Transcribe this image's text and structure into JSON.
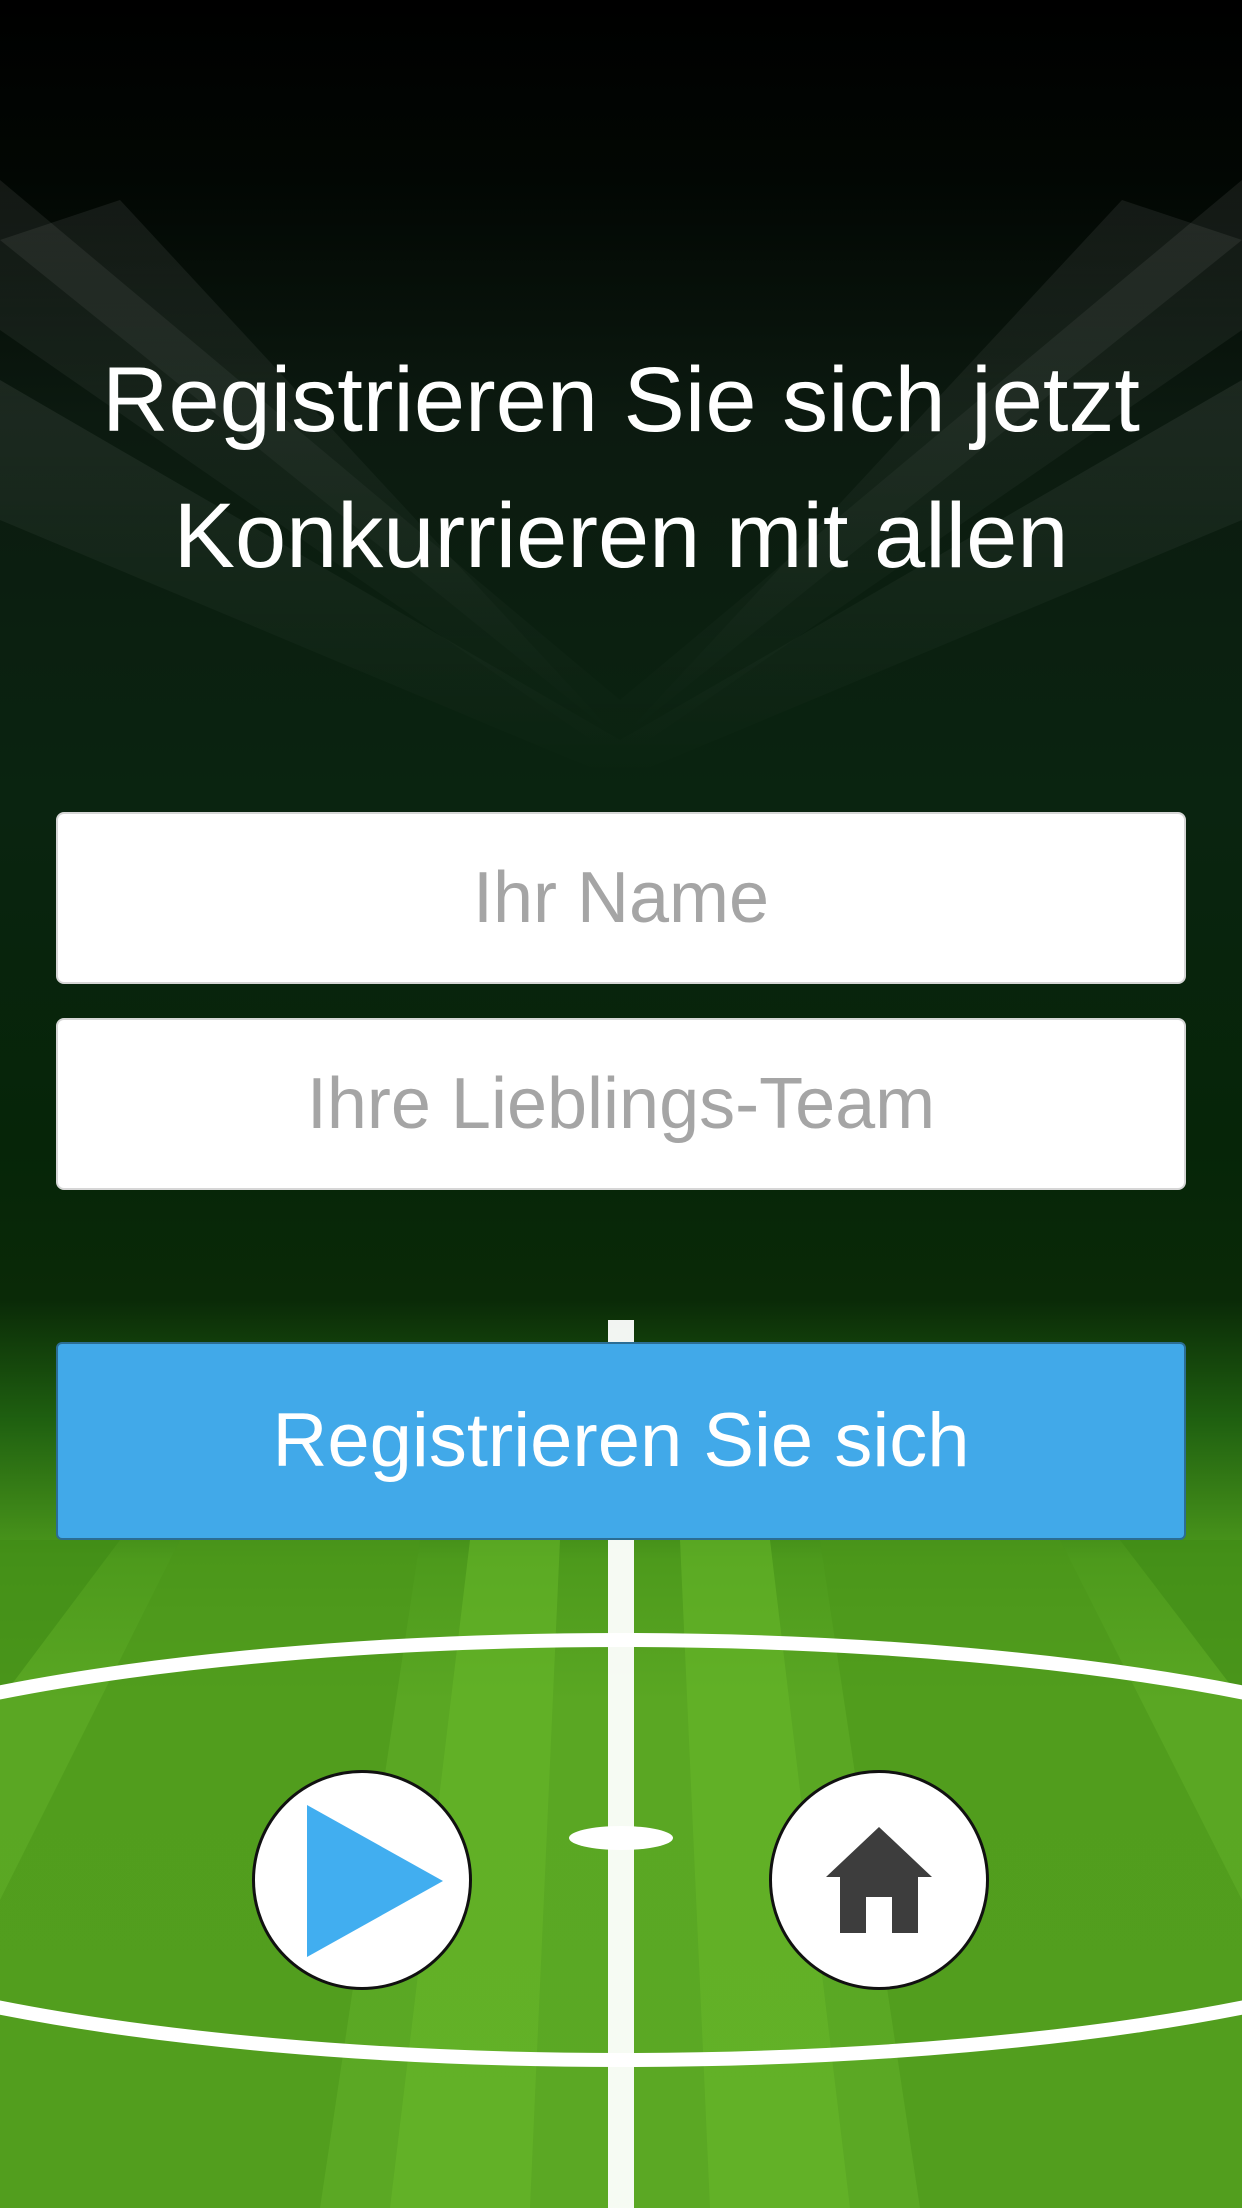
{
  "headline": {
    "line1": "Registrieren Sie sich jetzt",
    "line2": "Konkurrieren mit allen"
  },
  "form": {
    "name_placeholder": "Ihr Name",
    "name_value": "",
    "team_placeholder": "Ihre Lieblings-Team",
    "team_value": "",
    "submit_label": "Registrieren Sie sich"
  },
  "controls": {
    "play_icon": "play-icon",
    "home_icon": "home-icon"
  },
  "colors": {
    "primary_button": "#41a9e9",
    "play_icon": "#41aef0",
    "home_icon": "#3d3d3d",
    "pitch_green": "#5aa723"
  }
}
